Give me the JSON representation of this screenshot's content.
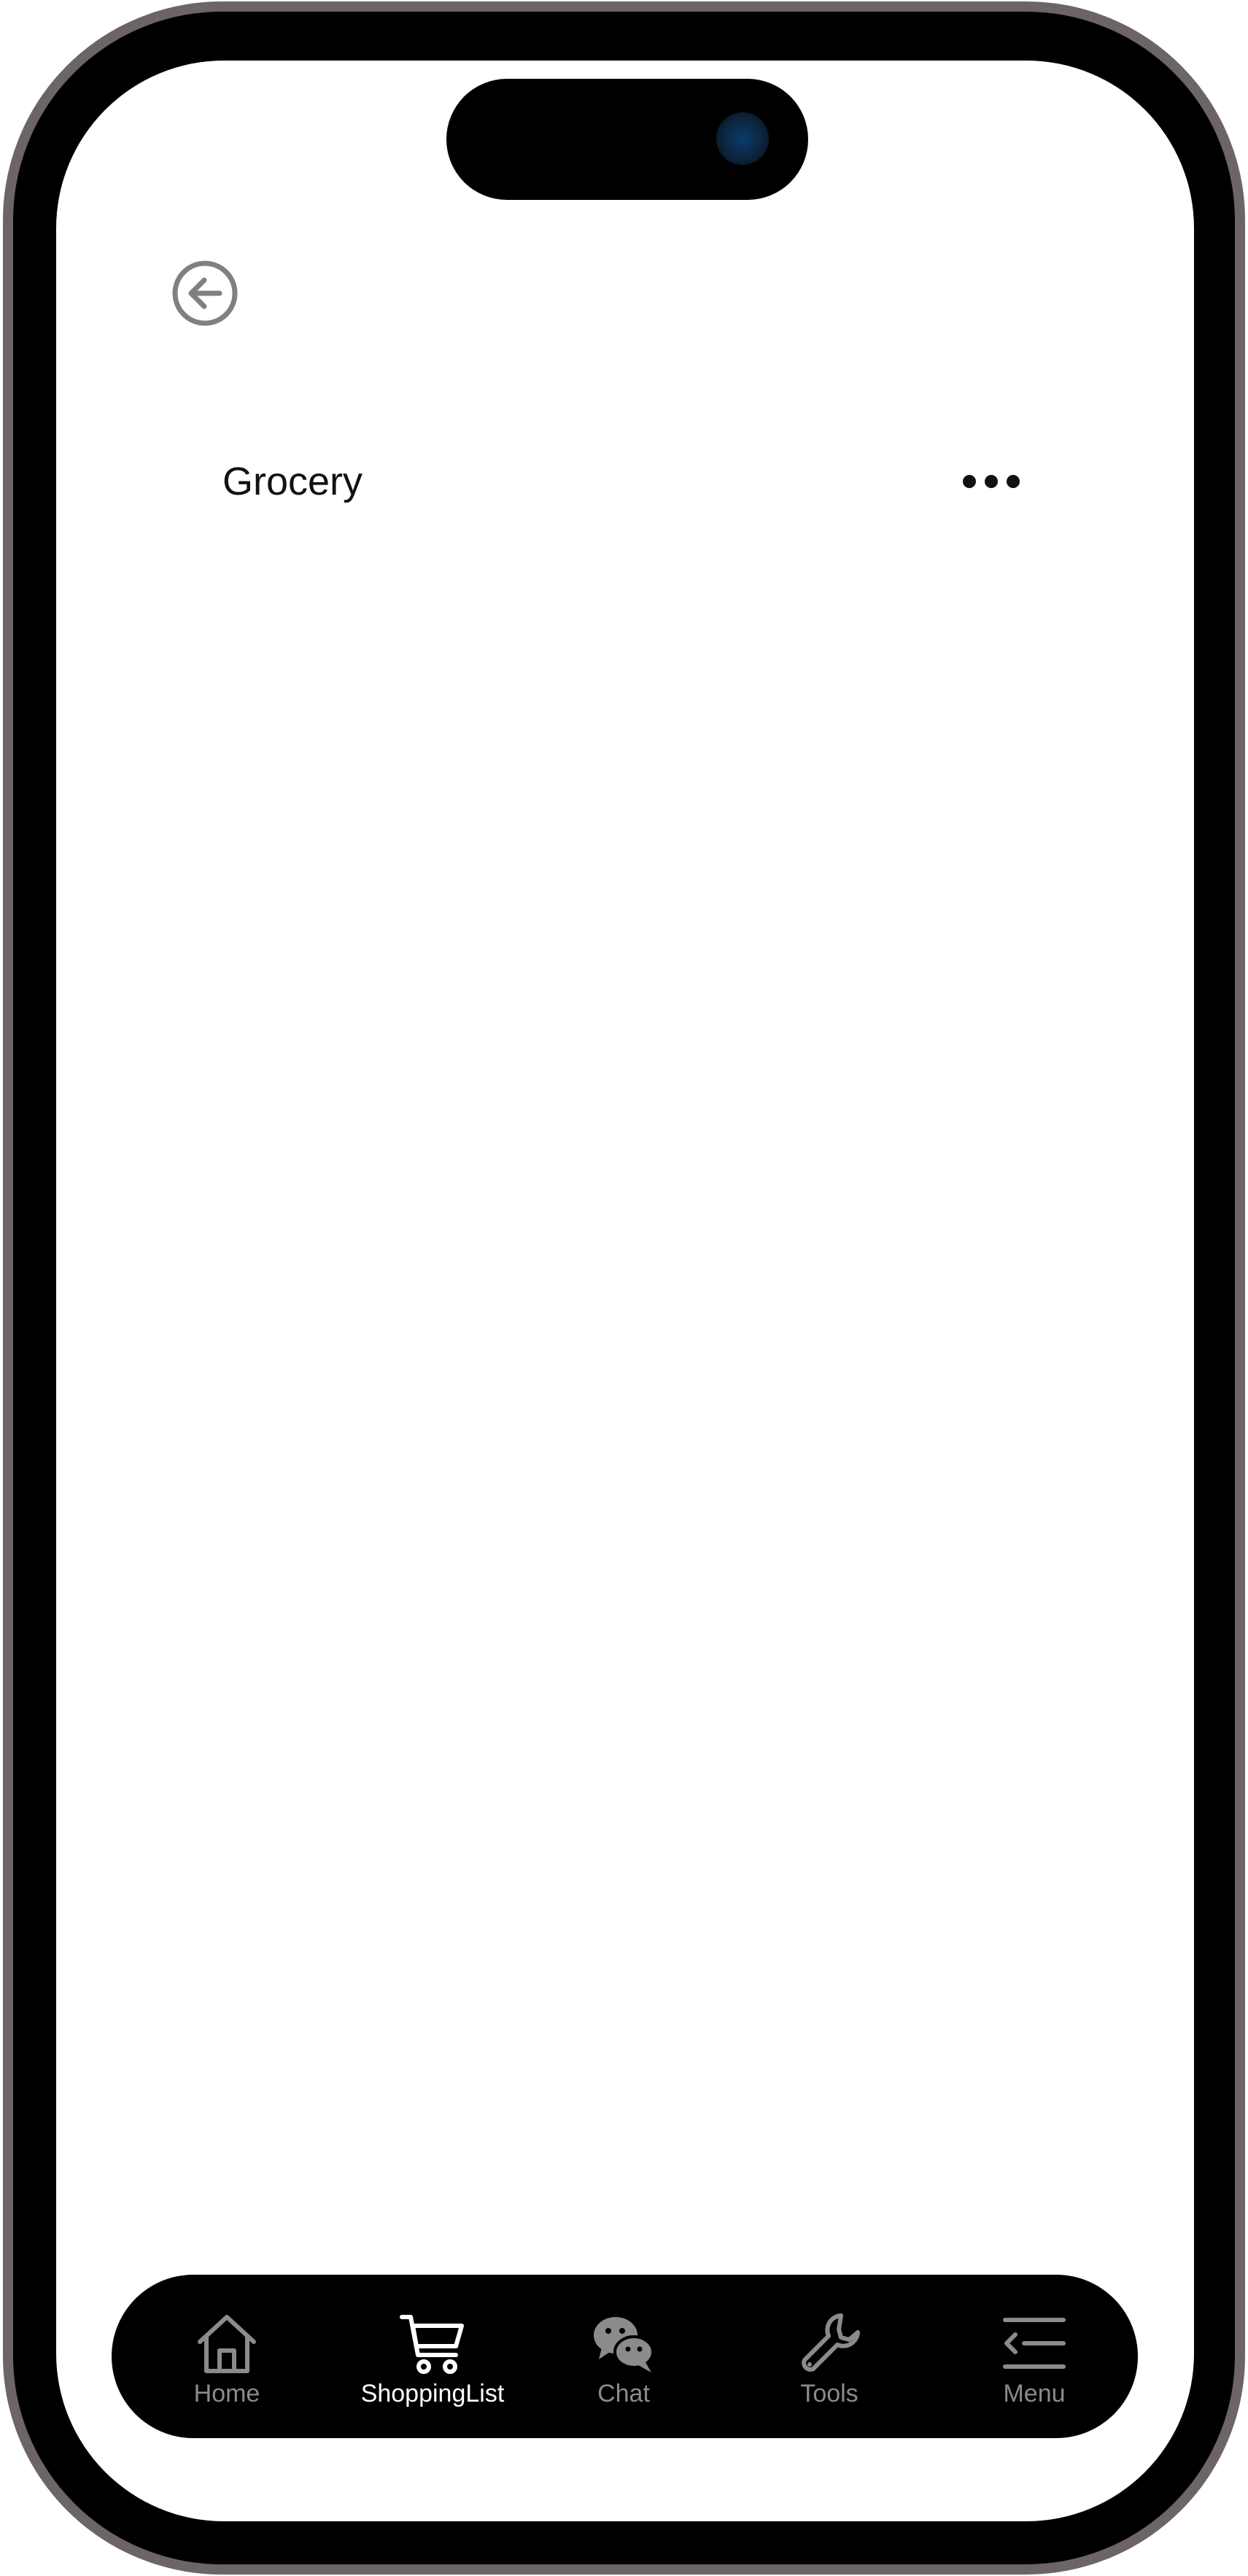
{
  "header": {
    "title": "Grocery",
    "back_icon": "arrow-left-circle-icon",
    "more_icon": "more-horizontal-icon"
  },
  "tab_bar": {
    "active": "ShoppingList",
    "items": [
      {
        "label": "Home",
        "icon": "home-icon"
      },
      {
        "label": "ShoppingList",
        "icon": "shopping-cart-icon"
      },
      {
        "label": "Chat",
        "icon": "chat-bubbles-icon"
      },
      {
        "label": "Tools",
        "icon": "wrench-icon"
      },
      {
        "label": "Menu",
        "icon": "menu-icon"
      }
    ]
  },
  "colors": {
    "frame": "#6d6466",
    "tab_bar_bg": "#000000",
    "tab_inactive": "#8b8b8b",
    "tab_active": "#ffffff",
    "back_icon": "#808080"
  }
}
